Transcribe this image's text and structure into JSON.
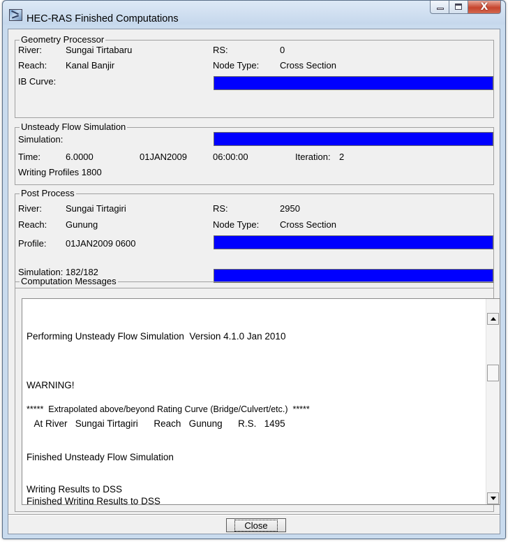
{
  "window": {
    "title": "HEC-RAS Finished Computations",
    "close_glyph": "X"
  },
  "geometry": {
    "legend": "Geometry Processor",
    "river_label": "River:",
    "river_value": "Sungai Tirtabaru",
    "rs_label": "RS:",
    "rs_value": "0",
    "reach_label": "Reach:",
    "reach_value": "Kanal Banjir",
    "node_type_label": "Node Type:",
    "node_type_value": "Cross Section",
    "ib_curve_label": "IB Curve:",
    "ib_curve_progress": 1.0
  },
  "unsteady": {
    "legend": "Unsteady Flow Simulation",
    "simulation_label": "Simulation:",
    "simulation_progress": 1.0,
    "time_label": "Time:",
    "time_value": "6.0000",
    "date_value": "01JAN2009",
    "clock_value": "06:00:00",
    "iteration_label": "Iteration:",
    "iteration_value": "2",
    "writing_profiles": "Writing Profiles 1800"
  },
  "post": {
    "legend": "Post Process",
    "river_label": "River:",
    "river_value": "Sungai Tirtagiri",
    "rs_label": "RS:",
    "rs_value": "2950",
    "reach_label": "Reach:",
    "reach_value": "Gunung",
    "node_type_label": "Node Type:",
    "node_type_value": "Cross Section",
    "profile_label": "Profile:",
    "profile_value": "01JAN2009 0600",
    "profile_progress": 1.0,
    "simulation_text": "Simulation: 182/182",
    "simulation_progress": 1.0
  },
  "messages": {
    "legend": "Computation Messages",
    "lines": [
      "Performing Unsteady Flow Simulation  Version 4.1.0 Jan 2010",
      "WARNING!",
      "*****  Extrapolated above/beyond Rating Curve (Bridge/Culvert/etc.)  *****",
      "   At River   Sungai Tirtagiri      Reach   Gunung      R.S.   1495",
      "Finished Unsteady Flow Simulation",
      "Writing Results to DSS",
      "Finished Writing Results to DSS"
    ],
    "scroll_position": 0.32
  },
  "buttons": {
    "close_label": "Close"
  }
}
